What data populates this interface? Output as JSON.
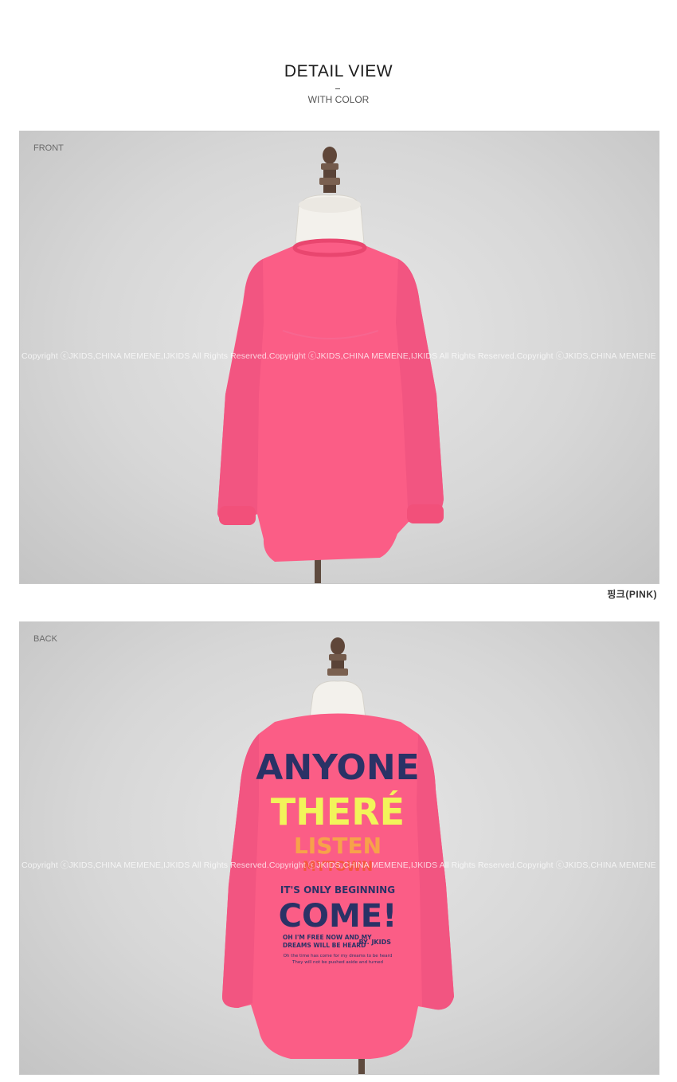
{
  "header": {
    "title": "DETAIL VIEW",
    "dash": "–",
    "subtitle": "WITH COLOR"
  },
  "front": {
    "label": "FRONT",
    "watermark": "Copyright ⓒJKIDS,CHINA MEMENE,IJKIDS All Rights Reserved.Copyright ⓒJKIDS,CHINA MEMENE,IJKIDS All Rights Reserved.Copyright ⓒJKIDS,CHINA MEMENE",
    "caption": "핑크(PINK)"
  },
  "back": {
    "label": "BACK",
    "watermark": "Copyright ⓒJKIDS,CHINA MEMENE,IJKIDS All Rights Reserved.Copyright ⓒJKIDS,CHINA MEMENE,IJKIDS All Rights Reserved.Copyright ⓒJKIDS,CHINA MEMENE",
    "print": {
      "line1": "ANYONE",
      "line2": "THERÉ",
      "line3": "LISTEN",
      "line4": "MYTOWN",
      "line5": "IT'S ONLY BEGINNING",
      "line6": "COME!",
      "line7": "OH I'M FREE NOW AND MY",
      "line8": "DREAMS WILL BE HEARD",
      "line9": "BY. JKIDS",
      "line10": "Oh the time has come for my dreams to be heard",
      "line11": "They will not be pushed aside and turned"
    }
  },
  "colors": {
    "garment": "#fb5d86",
    "garment_shade": "#e84a74",
    "navy_print": "#2a3266",
    "yellow_print": "#f2f45a",
    "orange_print": "#f7a24a",
    "red_print": "#f4583f",
    "mannequin_head": "#f4f2ee",
    "wood": "#6b5447"
  }
}
